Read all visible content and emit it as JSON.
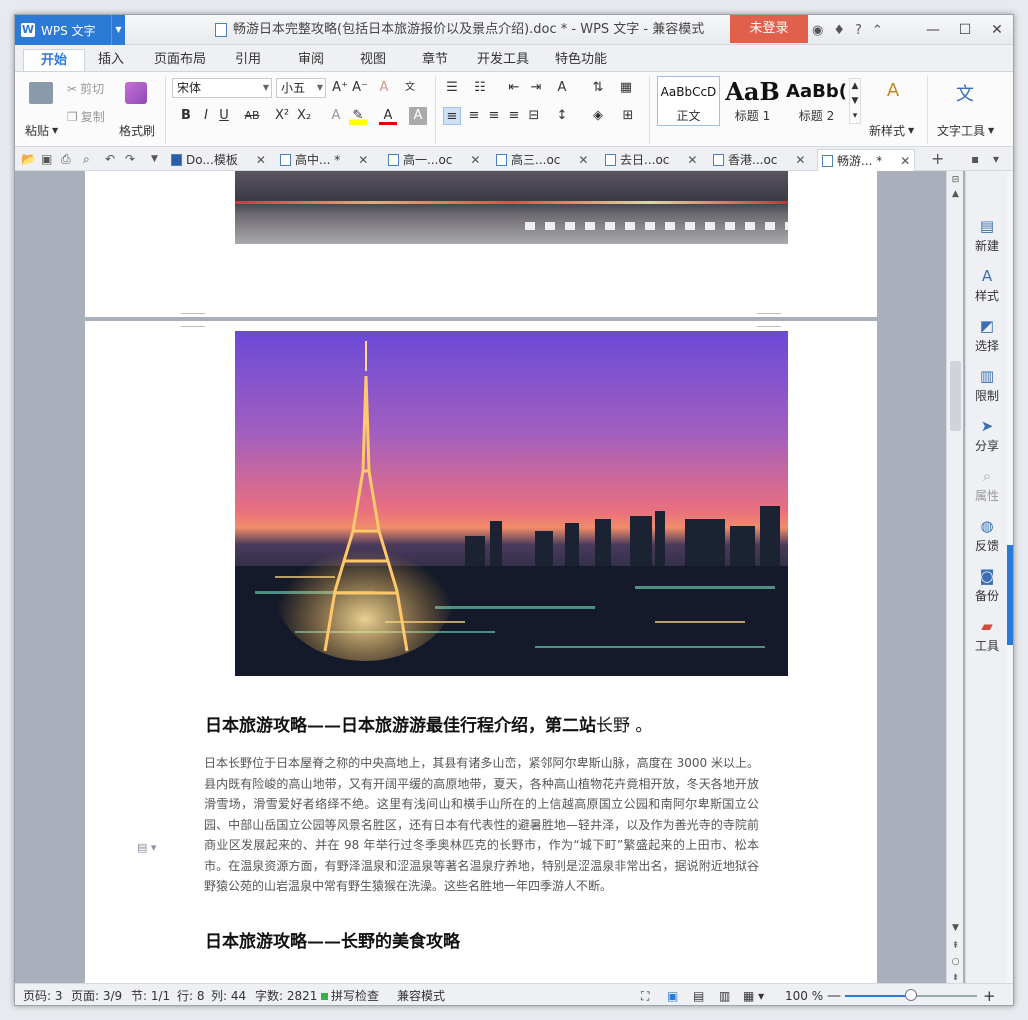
{
  "title_bar": {
    "app_name": "WPS 文字",
    "document_title": "畅游日本完整攻略(包括日本旅游报价以及景点介绍).doc * - WPS 文字 - 兼容模式",
    "login_label": "未登录"
  },
  "ribbon_tabs": [
    "开始",
    "插入",
    "页面布局",
    "引用",
    "审阅",
    "视图",
    "章节",
    "开发工具",
    "特色功能"
  ],
  "ribbon": {
    "paste": "粘贴",
    "cut": "剪切",
    "copy": "复制",
    "format_painter": "格式刷",
    "font_name": "宋体",
    "font_size": "小五",
    "styles": [
      {
        "preview": "AaBbCcD",
        "name": "正文"
      },
      {
        "preview": "AaB",
        "name": "标题 1"
      },
      {
        "preview": "AaBb(",
        "name": "标题 2"
      }
    ],
    "new_style": "新样式",
    "text_tools": "文字工具"
  },
  "doc_tabs": [
    {
      "label": "Do...模板"
    },
    {
      "label": "高中... *"
    },
    {
      "label": "高一...oc"
    },
    {
      "label": "高三...oc"
    },
    {
      "label": "去日...oc"
    },
    {
      "label": "香港...oc"
    },
    {
      "label": "畅游... *"
    }
  ],
  "document": {
    "heading1_main": "日本旅游攻略——日本旅游游最佳行程介绍，第二站",
    "heading1_tail": "长野 。",
    "paragraph": "日本长野位于日本屋脊之称的中央高地上，其县有诸多山峦，紧邻阿尔卑斯山脉，高度在 3000 米以上。县内既有险峻的高山地带，又有开阔平缓的高原地带，夏天，各种高山植物花卉竟相开放，冬天各地开放滑雪场，滑雪爱好者络绎不绝。这里有浅间山和横手山所在的上信越高原国立公园和南阿尔卑斯国立公园、中部山岳国立公园等风景名胜区，还有日本有代表性的避暑胜地—轻井泽，以及作为善光寺的寺院前商业区发展起来的、并在 98 年举行过冬季奥林匹克的长野市，作为“城下町”繁盛起来的上田市、松本市。在温泉资源方面，有野泽温泉和涩温泉等著名温泉疗养地，特别是涩温泉非常出名，据说附近地狱谷野猿公苑的山岩温泉中常有野生猿猴在洗澡。这些名胜地一年四季游人不断。",
    "heading2": "日本旅游攻略——长野的美食攻略"
  },
  "task_pane": [
    "新建",
    "样式",
    "选择",
    "限制",
    "分享",
    "属性",
    "反馈",
    "备份",
    "工具"
  ],
  "status_bar": {
    "page_code": "页码: 3",
    "pages": "页面: 3/9",
    "section": "节: 1/1",
    "row": "行: 8",
    "col": "列: 44",
    "word_count": "字数: 2821",
    "spell_check": "拼写检查",
    "compat_mode": "兼容模式",
    "zoom": "100 %",
    "zoom_fraction": 0.5
  },
  "colors": {
    "accent": "#2d7ad6",
    "login": "#e0604c"
  }
}
